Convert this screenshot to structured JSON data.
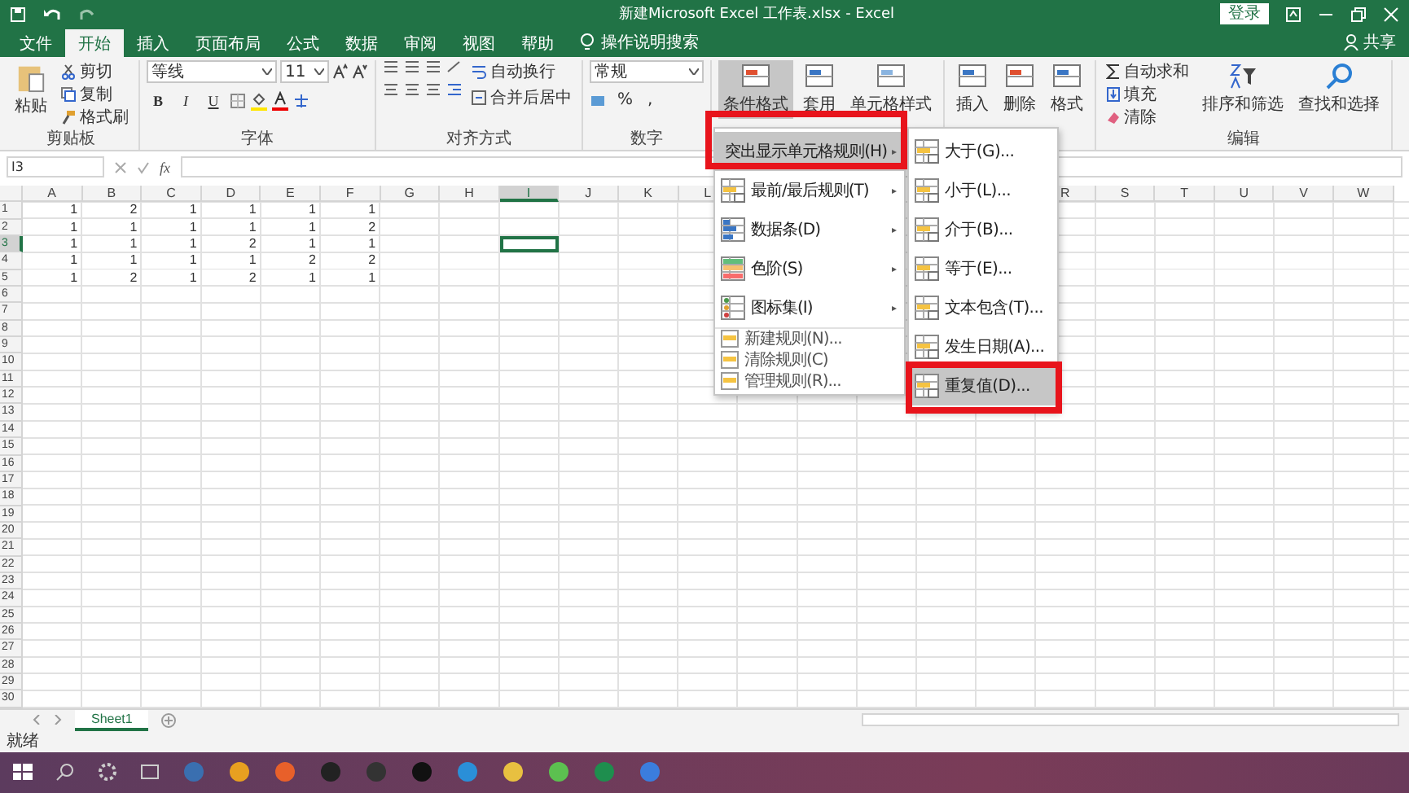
{
  "title_bar": {
    "title": "新建Microsoft Excel 工作表.xlsx - Excel",
    "sign_in": "登录"
  },
  "tabs": [
    {
      "label": "文件",
      "selected": false
    },
    {
      "label": "开始",
      "selected": true
    },
    {
      "label": "插入",
      "selected": false
    },
    {
      "label": "页面布局",
      "selected": false
    },
    {
      "label": "公式",
      "selected": false
    },
    {
      "label": "数据",
      "selected": false
    },
    {
      "label": "审阅",
      "selected": false
    },
    {
      "label": "视图",
      "selected": false
    },
    {
      "label": "帮助",
      "selected": false
    }
  ],
  "tell_me": "操作说明搜索",
  "share": "共享",
  "ribbon": {
    "clipboard": {
      "paste": "粘贴",
      "cut": "剪切",
      "copy": "复制",
      "format_painter": "格式刷",
      "label": "剪贴板"
    },
    "font": {
      "name": "等线",
      "size": "11",
      "bold": "B",
      "italic": "I",
      "underline": "U",
      "label": "字体"
    },
    "alignment": {
      "wrap": "自动换行",
      "merge": "合并后居中",
      "label": "对齐方式"
    },
    "number": {
      "format": "常规",
      "percent": "%",
      "comma": ",",
      "label": "数字"
    },
    "styles": {
      "conditional": {
        "label": "条件格式",
        "selected": true
      },
      "table": "套用",
      "cell_styles": "单元格样式"
    },
    "cells": {
      "insert": "插入",
      "delete": "删除",
      "format": "格式"
    },
    "editing": {
      "autosum": "自动求和",
      "fill": "填充",
      "clear": "清除",
      "sort": "排序和筛选",
      "find": "查找和选择",
      "label": "编辑"
    }
  },
  "formula_bar": {
    "name_box": "I3",
    "fx": "fx"
  },
  "sheet": {
    "columns_left": [
      {
        "label": "A",
        "selected": false
      },
      {
        "label": "B",
        "selected": false
      },
      {
        "label": "C",
        "selected": false
      },
      {
        "label": "D",
        "selected": false
      },
      {
        "label": "E",
        "selected": false
      },
      {
        "label": "F",
        "selected": false
      },
      {
        "label": "G",
        "selected": false
      },
      {
        "label": "H",
        "selected": false
      },
      {
        "label": "I",
        "selected": true
      },
      {
        "label": "J",
        "selected": false
      },
      {
        "label": "K",
        "selected": false
      },
      {
        "label": "L",
        "selected": false
      }
    ],
    "columns_right": [
      {
        "label": "R",
        "selected": false
      },
      {
        "label": "S",
        "selected": false
      },
      {
        "label": "T",
        "selected": false
      },
      {
        "label": "U",
        "selected": false
      },
      {
        "label": "V",
        "selected": false
      },
      {
        "label": "W",
        "selected": false
      }
    ],
    "rows": [
      {
        "label": "1",
        "selected": false,
        "cells": [
          "1",
          "2",
          "1",
          "1",
          "1",
          "1"
        ]
      },
      {
        "label": "2",
        "selected": false,
        "cells": [
          "1",
          "1",
          "1",
          "1",
          "1",
          "2"
        ]
      },
      {
        "label": "3",
        "selected": true,
        "cells": [
          "1",
          "1",
          "1",
          "2",
          "1",
          "1"
        ]
      },
      {
        "label": "4",
        "selected": false,
        "cells": [
          "1",
          "1",
          "1",
          "1",
          "2",
          "2"
        ]
      },
      {
        "label": "5",
        "selected": false,
        "cells": [
          "1",
          "2",
          "1",
          "2",
          "1",
          "1"
        ]
      },
      {
        "label": "6",
        "selected": false
      },
      {
        "label": "7",
        "selected": false
      },
      {
        "label": "8",
        "selected": false
      },
      {
        "label": "9",
        "selected": false
      },
      {
        "label": "10",
        "selected": false
      },
      {
        "label": "11",
        "selected": false
      },
      {
        "label": "12",
        "selected": false
      },
      {
        "label": "13",
        "selected": false
      },
      {
        "label": "14",
        "selected": false
      },
      {
        "label": "15",
        "selected": false
      },
      {
        "label": "16",
        "selected": false
      },
      {
        "label": "17",
        "selected": false
      },
      {
        "label": "18",
        "selected": false
      },
      {
        "label": "19",
        "selected": false
      },
      {
        "label": "20",
        "selected": false
      },
      {
        "label": "21",
        "selected": false
      },
      {
        "label": "22",
        "selected": false
      },
      {
        "label": "23",
        "selected": false
      },
      {
        "label": "24",
        "selected": false
      },
      {
        "label": "25",
        "selected": false
      },
      {
        "label": "26",
        "selected": false
      },
      {
        "label": "27",
        "selected": false
      },
      {
        "label": "28",
        "selected": false
      },
      {
        "label": "29",
        "selected": false
      },
      {
        "label": "30",
        "selected": false
      }
    ]
  },
  "cf_menu": {
    "items": [
      {
        "label": "突出显示单元格规则(H)",
        "kind": "large",
        "selected": true,
        "arrow": "▸"
      },
      {
        "label": "最前/最后规则(T)",
        "kind": "large",
        "selected": false,
        "arrow": "▸"
      },
      {
        "label": "数据条(D)",
        "kind": "large",
        "selected": false,
        "arrow": "▸"
      },
      {
        "label": "色阶(S)",
        "kind": "large",
        "selected": false,
        "arrow": "▸"
      },
      {
        "label": "图标集(I)",
        "kind": "large",
        "selected": false,
        "arrow": "▸"
      },
      {
        "label": "新建规则(N)...",
        "kind": "small",
        "selected": false
      },
      {
        "label": "清除规则(C)",
        "kind": "small",
        "selected": false
      },
      {
        "label": "管理规则(R)...",
        "kind": "small",
        "selected": false
      }
    ],
    "submenu": [
      {
        "label": "大于(G)...",
        "selected": false
      },
      {
        "label": "小于(L)...",
        "selected": false
      },
      {
        "label": "介于(B)...",
        "selected": false
      },
      {
        "label": "等于(E)...",
        "selected": false
      },
      {
        "label": "文本包含(T)...",
        "selected": false
      },
      {
        "label": "发生日期(A)...",
        "selected": false
      },
      {
        "label": "重复值(D)...",
        "selected": true
      }
    ]
  },
  "sheet_tabs": [
    {
      "label": "Sheet1",
      "selected": true
    }
  ],
  "status": "就绪"
}
